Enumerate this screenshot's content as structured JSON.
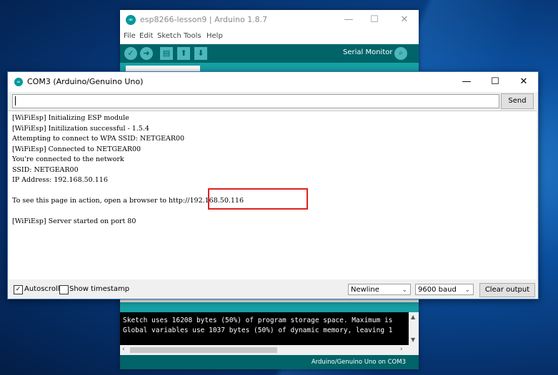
{
  "ide": {
    "title": "esp8266-lesson9 | Arduino 1.8.7",
    "menu": [
      "File",
      "Edit",
      "Sketch",
      "Tools",
      "Help"
    ],
    "serial_monitor_label": "Serial Monitor",
    "console_lines": [
      "Sketch uses 16208 bytes (50%) of program storage space. Maximum is",
      "Global variables use 1037 bytes (50%) of dynamic memory, leaving 1"
    ],
    "status": "Arduino/Genuino Uno on COM3"
  },
  "serial_monitor": {
    "title": "COM3 (Arduino/Genuino Uno)",
    "input_value": "",
    "send_label": "Send",
    "output_lines": [
      "[WiFiEsp] Initializing ESP module",
      "[WiFiEsp] Initilization successful - 1.5.4",
      "Attempting to connect to WPA SSID: NETGEAR00",
      "[WiFiEsp] Connected to NETGEAR00",
      "You're connected to the network",
      "SSID: NETGEAR00",
      "IP Address: 192.168.50.116",
      "",
      "To see this page in action, open a browser to http://192.168.50.116",
      "",
      "[WiFiEsp] Server started on port 80"
    ],
    "autoscroll_label": "Autoscroll",
    "autoscroll_checked": true,
    "timestamp_label": "Show timestamp",
    "timestamp_checked": false,
    "line_ending": "Newline",
    "baud": "9600 baud",
    "clear_label": "Clear output"
  },
  "colors": {
    "ide_teal": "#17a1a5",
    "ide_dark_teal": "#006468",
    "highlight": "#e02020"
  }
}
